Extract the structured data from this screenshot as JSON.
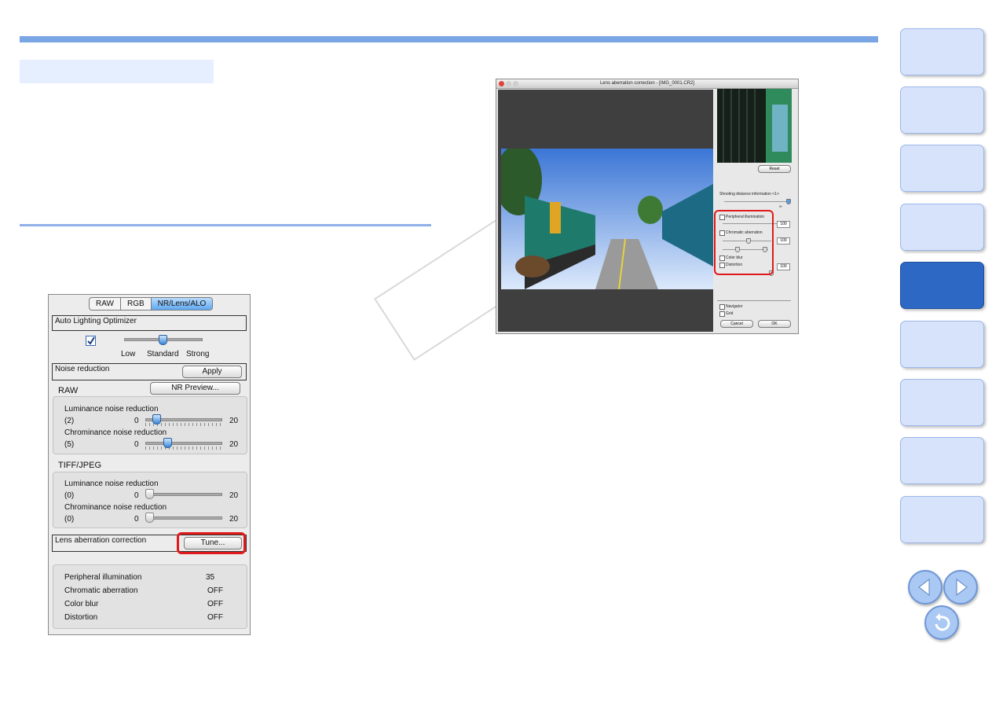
{
  "palette": {
    "tabs": [
      "RAW",
      "RGB",
      "NR/Lens/ALO"
    ],
    "alo_title": "Auto Lighting Optimizer",
    "alo_levels": [
      "Low",
      "Standard",
      "Strong"
    ],
    "alo_level_index": 1,
    "alo_checked": true,
    "nr_title": "Noise reduction",
    "apply_label": "Apply",
    "raw_label": "RAW",
    "nr_preview_label": "NR Preview...",
    "raw_luminance": {
      "label": "Luminance noise reduction",
      "value": "(2)",
      "min": "0",
      "max": "20",
      "level": 2
    },
    "raw_chrominance": {
      "label": "Chrominance noise reduction",
      "value": "(5)",
      "min": "0",
      "max": "20",
      "level": 5
    },
    "tiff_label": "TIFF/JPEG",
    "tiff_luminance": {
      "label": "Luminance noise reduction",
      "value": "(0)",
      "min": "0",
      "max": "20",
      "level": 0
    },
    "tiff_chrominance": {
      "label": "Chrominance noise reduction",
      "value": "(0)",
      "min": "0",
      "max": "20",
      "level": 0
    },
    "lens_title": "Lens aberration correction",
    "tune_label": "Tune...",
    "summary": [
      {
        "label": "Peripheral illumination",
        "value": "35"
      },
      {
        "label": "Chromatic aberration",
        "value": "OFF"
      },
      {
        "label": "Color blur",
        "value": "OFF"
      },
      {
        "label": "Distortion",
        "value": "OFF"
      }
    ]
  },
  "dialog": {
    "title": "Lens aberration correction - [IMG_0001.CR2]",
    "reset_label": "Reset",
    "shooting_distance_label": "Shooting distance information <1>",
    "infinity_label": "∞",
    "peripheral_label": "Peripheral illumination",
    "peripheral_value": "100",
    "chromatic_label": "Chromatic aberration",
    "chromatic_value": "100",
    "colorblur_label": "Color blur",
    "distortion_label": "Distortion",
    "distortion_value": "100",
    "navigator_label": "Navigator",
    "navigator_checked": true,
    "grid_label": "Grid",
    "cancel_label": "Cancel",
    "ok_label": "OK"
  },
  "colors": {
    "accent": "#7aa6e6",
    "active_tab": "#2d68c4",
    "highlight": "#e01a1a"
  }
}
